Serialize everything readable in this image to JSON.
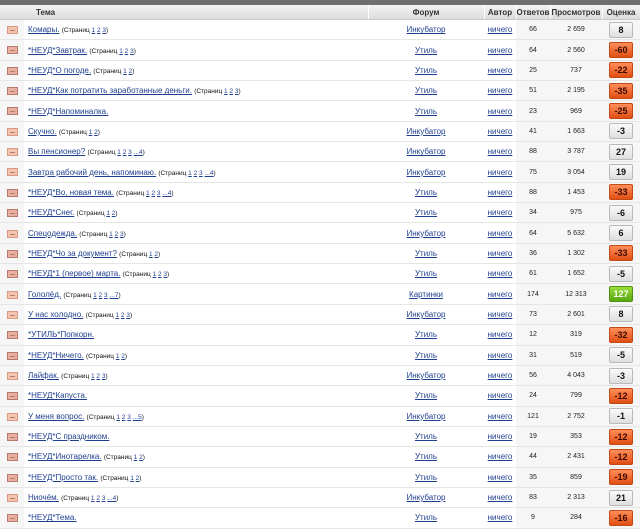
{
  "header": {
    "topic": "Тема",
    "forum": "Форум",
    "author": "Автор",
    "replies": "Ответов",
    "views": "Просмотров",
    "rating": "Оценка"
  },
  "rows": [
    {
      "title": "Комары.",
      "pages_prefix": "(Страниц ",
      "pages": [
        "1",
        "2",
        "3"
      ],
      "pages_suffix": ")",
      "forum": "Инкубатор",
      "author": "ничего",
      "replies": "66",
      "views": "2 659",
      "rating": "8",
      "rating_type": "neutral",
      "icon": "light"
    },
    {
      "title": "*НЕУД*Завтрак.",
      "pages_prefix": "(Страниц ",
      "pages": [
        "1",
        "2",
        "3"
      ],
      "pages_suffix": ")",
      "forum": "Утиль",
      "author": "ничего",
      "replies": "64",
      "views": "2 560",
      "rating": "-60",
      "rating_type": "neg",
      "icon": "dark"
    },
    {
      "title": "*НЕУД*О погоде.",
      "pages_prefix": "(Страниц ",
      "pages": [
        "1",
        "2"
      ],
      "pages_suffix": ")",
      "forum": "Утиль",
      "author": "ничего",
      "replies": "25",
      "views": "737",
      "rating": "-22",
      "rating_type": "neg",
      "icon": "dark"
    },
    {
      "title": "*НЕУД*Как потратить заработанные деньги.",
      "pages_prefix": "(Страниц ",
      "pages": [
        "1",
        "2",
        "3"
      ],
      "pages_suffix": ")",
      "forum": "Утиль",
      "author": "ничего",
      "replies": "51",
      "views": "2 195",
      "rating": "-35",
      "rating_type": "neg",
      "icon": "dark"
    },
    {
      "title": "*НЕУД*Напоминалка.",
      "pages_prefix": "",
      "pages": [],
      "pages_suffix": "",
      "forum": "Утиль",
      "author": "ничего",
      "replies": "23",
      "views": "969",
      "rating": "-25",
      "rating_type": "neg",
      "icon": "dark"
    },
    {
      "title": "Скучно.",
      "pages_prefix": "(Страниц ",
      "pages": [
        "1",
        "2"
      ],
      "pages_suffix": ")",
      "forum": "Инкубатор",
      "author": "ничего",
      "replies": "41",
      "views": "1 663",
      "rating": "-3",
      "rating_type": "neutral",
      "icon": "light"
    },
    {
      "title": "Вы пенсионер?",
      "pages_prefix": "(Страниц ",
      "pages": [
        "1",
        "2",
        "3",
        "...4"
      ],
      "pages_suffix": ")",
      "forum": "Инкубатор",
      "author": "ничего",
      "replies": "88",
      "views": "3 787",
      "rating": "27",
      "rating_type": "neutral",
      "icon": "light"
    },
    {
      "title": "Завтра рабочий день, напоминаю.",
      "pages_prefix": "(Страниц ",
      "pages": [
        "1",
        "2",
        "3",
        "...4"
      ],
      "pages_suffix": ")",
      "forum": "Инкубатор",
      "author": "ничего",
      "replies": "75",
      "views": "3 054",
      "rating": "19",
      "rating_type": "neutral",
      "icon": "light"
    },
    {
      "title": "*НЕУД*Во, новая тема.",
      "pages_prefix": "(Страниц ",
      "pages": [
        "1",
        "2",
        "3",
        "...4"
      ],
      "pages_suffix": ")",
      "forum": "Утиль",
      "author": "ничего",
      "replies": "88",
      "views": "1 453",
      "rating": "-33",
      "rating_type": "neg",
      "icon": "dark"
    },
    {
      "title": "*НЕУД*Снег.",
      "pages_prefix": "(Страниц ",
      "pages": [
        "1",
        "2"
      ],
      "pages_suffix": ")",
      "forum": "Утиль",
      "author": "ничего",
      "replies": "34",
      "views": "975",
      "rating": "-6",
      "rating_type": "neutral",
      "icon": "dark"
    },
    {
      "title": "Спецодежда.",
      "pages_prefix": "(Страниц ",
      "pages": [
        "1",
        "2",
        "3"
      ],
      "pages_suffix": ")",
      "forum": "Инкубатор",
      "author": "ничего",
      "replies": "64",
      "views": "5 632",
      "rating": "6",
      "rating_type": "neutral",
      "icon": "light"
    },
    {
      "title": "*НЕУД*Чо за документ?",
      "pages_prefix": "(Страниц ",
      "pages": [
        "1",
        "2"
      ],
      "pages_suffix": ")",
      "forum": "Утиль",
      "author": "ничего",
      "replies": "36",
      "views": "1 302",
      "rating": "-33",
      "rating_type": "neg",
      "icon": "dark"
    },
    {
      "title": "*НЕУД*1 (первое) марта.",
      "pages_prefix": "(Страниц ",
      "pages": [
        "1",
        "2",
        "3"
      ],
      "pages_suffix": ")",
      "forum": "Утиль",
      "author": "ничего",
      "replies": "61",
      "views": "1 652",
      "rating": "-5",
      "rating_type": "neutral",
      "icon": "dark"
    },
    {
      "title": "Гололёд.",
      "pages_prefix": "(Страниц ",
      "pages": [
        "1",
        "2",
        "3",
        "...7"
      ],
      "pages_suffix": ")",
      "forum": "Картинки",
      "author": "ничего",
      "replies": "174",
      "views": "12 313",
      "rating": "127",
      "rating_type": "pos",
      "icon": "light"
    },
    {
      "title": "У нас холодно.",
      "pages_prefix": "(Страниц ",
      "pages": [
        "1",
        "2",
        "3"
      ],
      "pages_suffix": ")",
      "forum": "Инкубатор",
      "author": "ничего",
      "replies": "73",
      "views": "2 601",
      "rating": "8",
      "rating_type": "neutral",
      "icon": "light"
    },
    {
      "title": "*УТИЛЬ*Попкорн.",
      "pages_prefix": "",
      "pages": [],
      "pages_suffix": "",
      "forum": "Утиль",
      "author": "ничего",
      "replies": "12",
      "views": "319",
      "rating": "-32",
      "rating_type": "neg",
      "icon": "dark"
    },
    {
      "title": "*НЕУД*Ничего.",
      "pages_prefix": "(Страниц ",
      "pages": [
        "1",
        "2"
      ],
      "pages_suffix": ")",
      "forum": "Утиль",
      "author": "ничего",
      "replies": "31",
      "views": "519",
      "rating": "-5",
      "rating_type": "neutral",
      "icon": "dark"
    },
    {
      "title": "Лайфак.",
      "pages_prefix": "(Страниц ",
      "pages": [
        "1",
        "2",
        "3"
      ],
      "pages_suffix": ")",
      "forum": "Инкубатор",
      "author": "ничего",
      "replies": "56",
      "views": "4 043",
      "rating": "-3",
      "rating_type": "neutral",
      "icon": "light"
    },
    {
      "title": "*НЕУД*Капуста.",
      "pages_prefix": "",
      "pages": [],
      "pages_suffix": "",
      "forum": "Утиль",
      "author": "ничего",
      "replies": "24",
      "views": "799",
      "rating": "-12",
      "rating_type": "neg",
      "icon": "dark"
    },
    {
      "title": "У меня вопрос.",
      "pages_prefix": "(Страниц ",
      "pages": [
        "1",
        "2",
        "3",
        "...5"
      ],
      "pages_suffix": ")",
      "forum": "Инкубатор",
      "author": "ничего",
      "replies": "121",
      "views": "2 752",
      "rating": "-1",
      "rating_type": "neutral",
      "icon": "light"
    },
    {
      "title": "*НЕУД*С праздником.",
      "pages_prefix": "",
      "pages": [],
      "pages_suffix": "",
      "forum": "Утиль",
      "author": "ничего",
      "replies": "19",
      "views": "353",
      "rating": "-12",
      "rating_type": "neg",
      "icon": "dark"
    },
    {
      "title": "*НЕУД*Инотарелка.",
      "pages_prefix": "(Страниц ",
      "pages": [
        "1",
        "2"
      ],
      "pages_suffix": ")",
      "forum": "Утиль",
      "author": "ничего",
      "replies": "44",
      "views": "2 431",
      "rating": "-12",
      "rating_type": "neg",
      "icon": "dark"
    },
    {
      "title": "*НЕУД*Просто так.",
      "pages_prefix": "(Страниц ",
      "pages": [
        "1",
        "2"
      ],
      "pages_suffix": ")",
      "forum": "Утиль",
      "author": "ничего",
      "replies": "35",
      "views": "859",
      "rating": "-19",
      "rating_type": "neg",
      "icon": "dark"
    },
    {
      "title": "Ниочём.",
      "pages_prefix": "(Страниц ",
      "pages": [
        "1",
        "2",
        "3",
        "...4"
      ],
      "pages_suffix": ")",
      "forum": "Инкубатор",
      "author": "ничего",
      "replies": "83",
      "views": "2 313",
      "rating": "21",
      "rating_type": "neutral",
      "icon": "light"
    },
    {
      "title": "*НЕУД*Тема.",
      "pages_prefix": "",
      "pages": [],
      "pages_suffix": "",
      "forum": "Утиль",
      "author": "ничего",
      "replies": "9",
      "views": "284",
      "rating": "-16",
      "rating_type": "neg",
      "icon": "dark"
    }
  ],
  "colors": {
    "link": "#1f3f8f",
    "rating_negative": "#e86a2e",
    "rating_positive": "#6bb81c",
    "rating_neutral": "#e9e9e9"
  }
}
